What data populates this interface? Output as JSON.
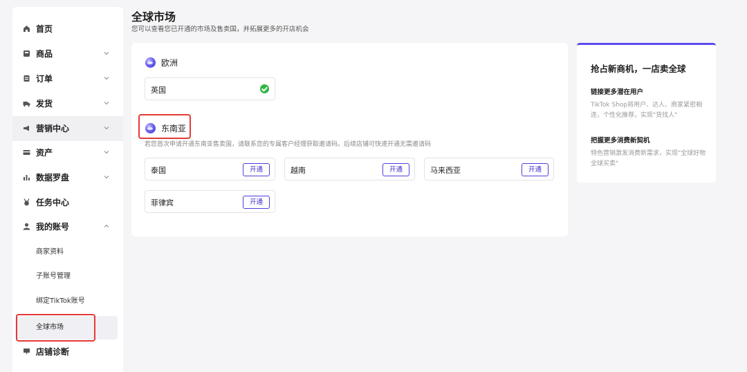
{
  "sidebar": {
    "items": [
      {
        "label": "首页",
        "icon": "home-icon",
        "expandable": false
      },
      {
        "label": "商品",
        "icon": "product-icon",
        "expandable": true
      },
      {
        "label": "订单",
        "icon": "order-icon",
        "expandable": true
      },
      {
        "label": "发货",
        "icon": "truck-icon",
        "expandable": true
      },
      {
        "label": "营销中心",
        "icon": "megaphone-icon",
        "expandable": true
      },
      {
        "label": "资产",
        "icon": "card-icon",
        "expandable": true
      },
      {
        "label": "数据罗盘",
        "icon": "bar-chart-icon",
        "expandable": true
      },
      {
        "label": "任务中心",
        "icon": "medal-icon",
        "expandable": false
      },
      {
        "label": "我的账号",
        "icon": "user-icon",
        "expandable": true,
        "expanded": true
      },
      {
        "label": "店铺诊断",
        "icon": "diagnosis-icon",
        "expandable": false
      }
    ],
    "account_sub_items": [
      "商家资料",
      "子账号管理",
      "绑定TikTok账号",
      "全球市场"
    ],
    "selected_sub_item": "全球市场"
  },
  "header": {
    "title": "全球市场",
    "subtitle": "您可以查看您已开通的市场及售卖国，并拓展更多的开店机会"
  },
  "regions": {
    "europe": {
      "name": "欧洲",
      "countries": [
        {
          "name": "英国",
          "status": "opened"
        }
      ]
    },
    "sea": {
      "name": "东南亚",
      "hint": "若您首次申请开通东南亚售卖国，请联系您的专属客户经理获取邀请码。后续店铺可快速开通无需邀请码",
      "open_label": "开通",
      "countries": [
        {
          "name": "泰国",
          "status": "available"
        },
        {
          "name": "越南",
          "status": "available"
        },
        {
          "name": "马来西亚",
          "status": "available"
        },
        {
          "name": "菲律宾",
          "status": "available"
        }
      ]
    }
  },
  "promo": {
    "title": "抢占新商机，一店卖全球",
    "sections": [
      {
        "heading": "链接更多潜在用户",
        "text": "TikTok Shop将用户、达人、商家紧密相连，个性化推荐，实现\"货找人\""
      },
      {
        "heading": "把握更多消费新契机",
        "text": "特色营销激发消费新需求，实现\"全球好物 全球买卖\""
      }
    ]
  },
  "colors": {
    "accent": "#4a3fdc",
    "success": "#2fb744",
    "highlight": "#e53935"
  }
}
